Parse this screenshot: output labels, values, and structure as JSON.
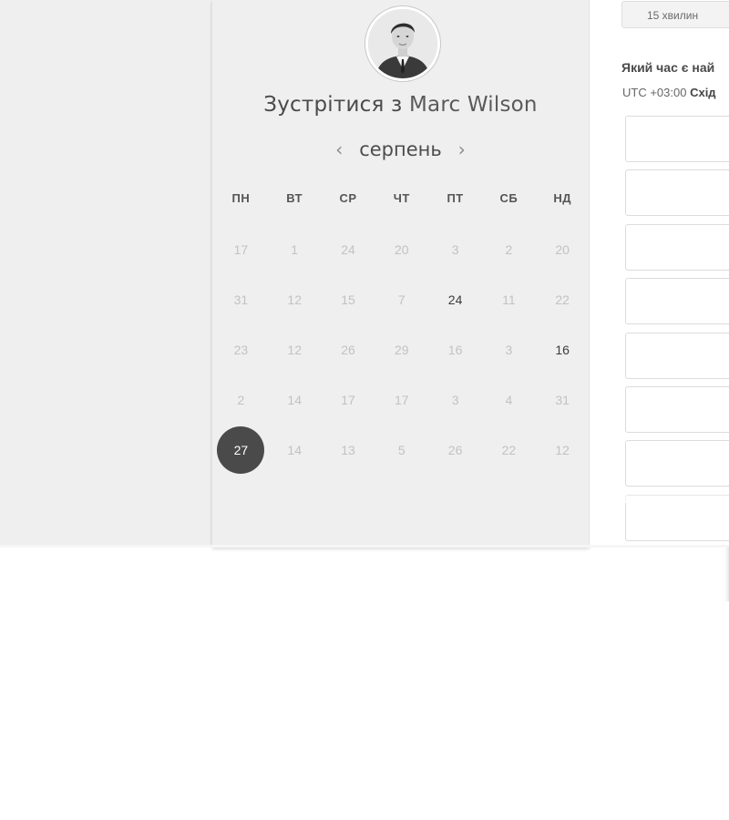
{
  "calendar": {
    "title_prefix": "Зустрітися з",
    "host_name": "Marc Wilson",
    "month": "серпень",
    "prev_label": "‹",
    "next_label": "›",
    "weekdays": [
      "ПН",
      "ВТ",
      "СР",
      "ЧТ",
      "ПТ",
      "СБ",
      "НД"
    ],
    "weeks": [
      [
        {
          "d": "17",
          "s": "disabled"
        },
        {
          "d": "1",
          "s": "disabled"
        },
        {
          "d": "24",
          "s": "disabled"
        },
        {
          "d": "20",
          "s": "disabled"
        },
        {
          "d": "3",
          "s": "disabled"
        },
        {
          "d": "2",
          "s": "disabled"
        },
        {
          "d": "20",
          "s": "disabled"
        }
      ],
      [
        {
          "d": "31",
          "s": "disabled"
        },
        {
          "d": "12",
          "s": "disabled"
        },
        {
          "d": "15",
          "s": "disabled"
        },
        {
          "d": "7",
          "s": "disabled"
        },
        {
          "d": "24",
          "s": "available"
        },
        {
          "d": "11",
          "s": "disabled"
        },
        {
          "d": "22",
          "s": "disabled"
        }
      ],
      [
        {
          "d": "23",
          "s": "disabled"
        },
        {
          "d": "12",
          "s": "disabled"
        },
        {
          "d": "26",
          "s": "disabled"
        },
        {
          "d": "29",
          "s": "disabled"
        },
        {
          "d": "16",
          "s": "disabled"
        },
        {
          "d": "3",
          "s": "disabled"
        },
        {
          "d": "16",
          "s": "available"
        }
      ],
      [
        {
          "d": "2",
          "s": "disabled"
        },
        {
          "d": "14",
          "s": "disabled"
        },
        {
          "d": "17",
          "s": "disabled"
        },
        {
          "d": "17",
          "s": "disabled"
        },
        {
          "d": "3",
          "s": "disabled"
        },
        {
          "d": "4",
          "s": "disabled"
        },
        {
          "d": "31",
          "s": "disabled"
        }
      ],
      [
        {
          "d": "27",
          "s": "selected"
        },
        {
          "d": "14",
          "s": "disabled"
        },
        {
          "d": "13",
          "s": "disabled"
        },
        {
          "d": "5",
          "s": "disabled"
        },
        {
          "d": "26",
          "s": "disabled"
        },
        {
          "d": "22",
          "s": "disabled"
        },
        {
          "d": "12",
          "s": "disabled"
        }
      ]
    ]
  },
  "booking": {
    "duration_label": "15 хвилин",
    "question": "Який час є най",
    "timezone_offset": "UTC +03:00",
    "timezone_name": "Схід",
    "slot_count": 8
  },
  "colors": {
    "selected_day": "#4a4a4a",
    "panel_bg": "#efefef"
  }
}
